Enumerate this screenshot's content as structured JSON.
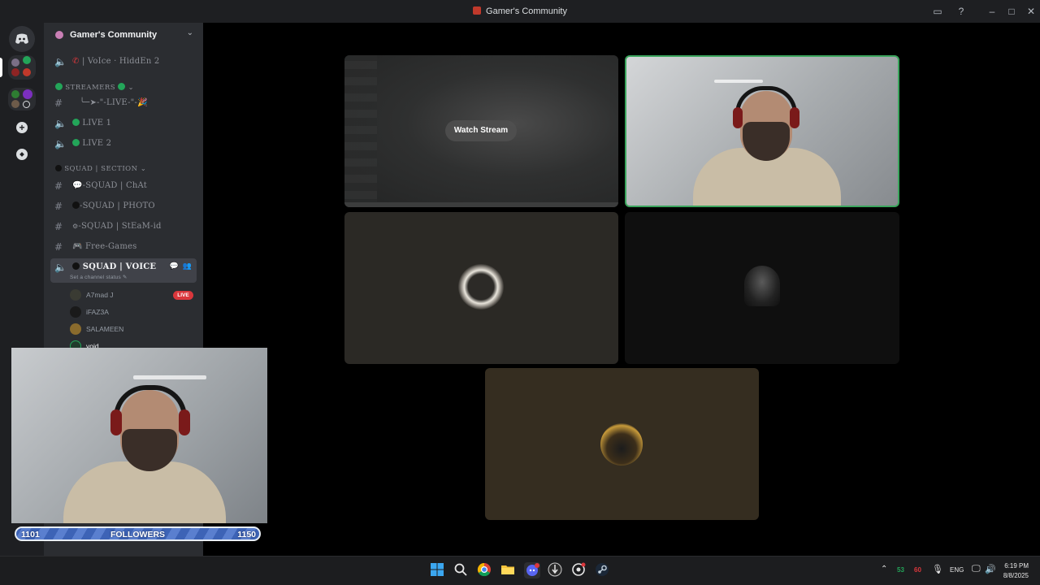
{
  "window": {
    "title": "Gamer's Community"
  },
  "server": {
    "name": "Gamer's Community"
  },
  "channels": {
    "top_voice": "| VoIce · HiddEn 2",
    "streamers_category": "STREAMERS",
    "live_text": "╰─➤-\"-LIVE-\"-🎉",
    "live1": "LIVE 1",
    "live2": "LIVE 2",
    "squad_category": "SQUAD | SECTION",
    "squad_chat": "-SQUAD | ChAt",
    "squad_photo": "-SQUAD | PHOTO",
    "squad_steam": "-SQUAD | StEaM-id",
    "free_games": "Free-Games",
    "squad_voice": "SQUAD | VOICE",
    "squad_voice_status": "Set a channel status"
  },
  "members": [
    "A7mad J",
    "iFAZ3A",
    "SALAMEEN",
    "void"
  ],
  "live_badge": "LIVE",
  "stage": {
    "watch_stream": "Watch Stream"
  },
  "followers": {
    "current": "1101",
    "label": "FOLLOWERS",
    "goal": "1150",
    "progress": 0.957
  },
  "taskbar": {
    "lang": "ENG",
    "tray_num1": "53",
    "tray_num2": "60",
    "time": "6:19 PM",
    "date": "8/8/2025"
  },
  "colors": {
    "accent_green": "#23a559",
    "live_red": "#da373c",
    "stream_border": "#3ba55d"
  }
}
